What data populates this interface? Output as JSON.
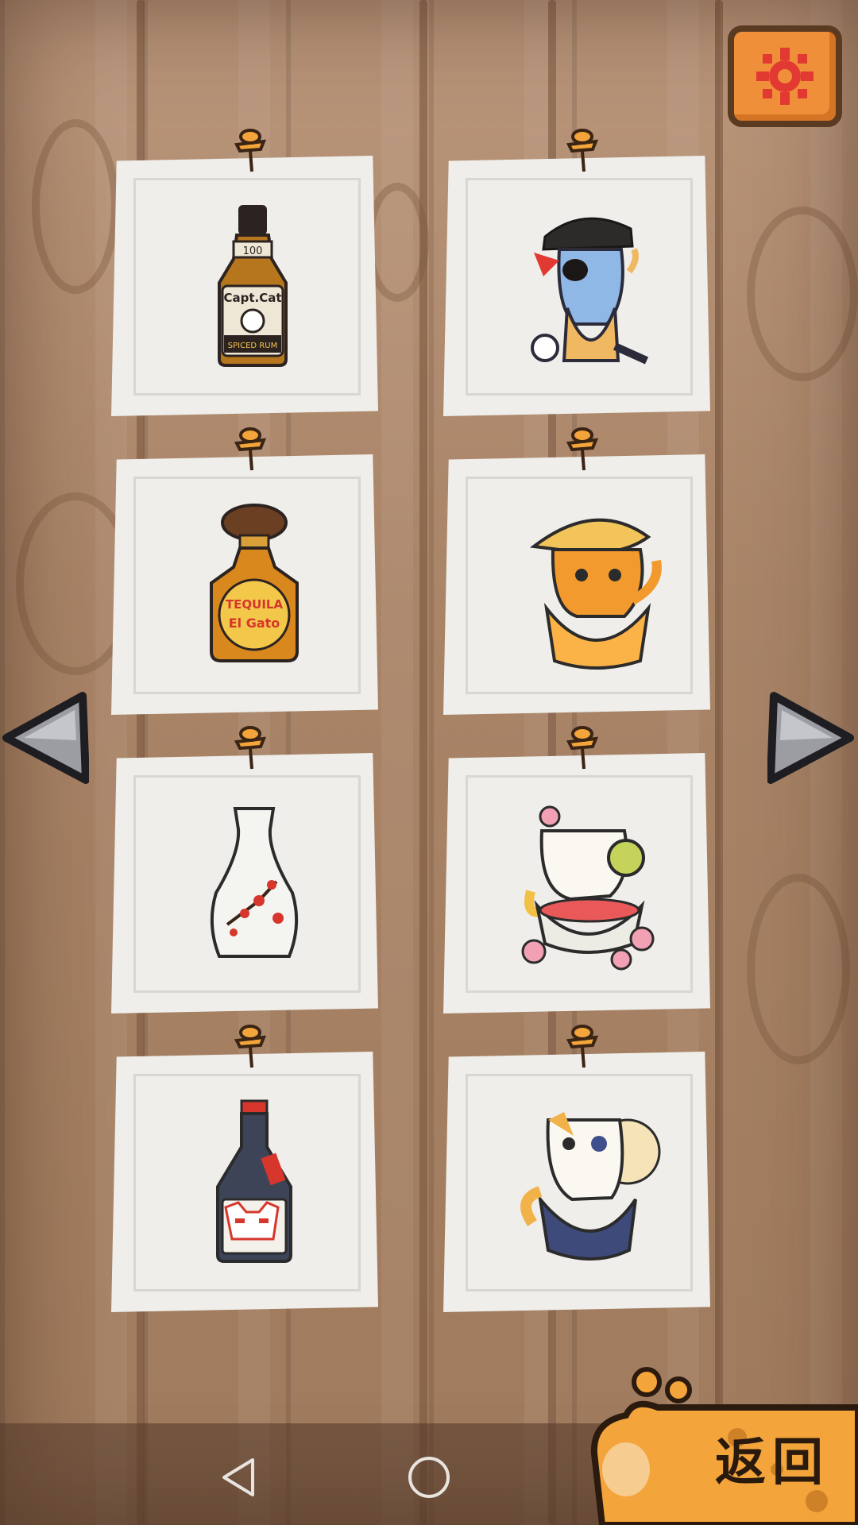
{
  "screen": {
    "settings_icon": "gear-icon",
    "prev_icon": "left-triangle-icon",
    "next_icon": "right-triangle-icon",
    "back_label": "返回"
  },
  "cards": [
    {
      "name": "captain-cat-rum-bottle",
      "label_line1": "Capt.Cat",
      "label_line2": "SPICED RUM",
      "badge": "100"
    },
    {
      "name": "pirate-cat-in-glass"
    },
    {
      "name": "tequila-el-gato-bottle",
      "label_line1": "TEQUILA",
      "label_line2": "El Gato"
    },
    {
      "name": "sombrero-cat-in-cup"
    },
    {
      "name": "sake-vase-plum-blossom"
    },
    {
      "name": "blossom-cat-in-bowl"
    },
    {
      "name": "kitsune-mask-sake-bottle"
    },
    {
      "name": "calico-cat-in-cup"
    }
  ],
  "system_nav": {
    "back_icon": "nav-back-icon",
    "home_icon": "nav-home-icon",
    "recents_icon": "nav-recents-icon"
  },
  "colors": {
    "wood": "#a98467",
    "card": "#efeeea",
    "settings_orange": "#f08f3a",
    "paw_orange": "#f3a43a"
  }
}
